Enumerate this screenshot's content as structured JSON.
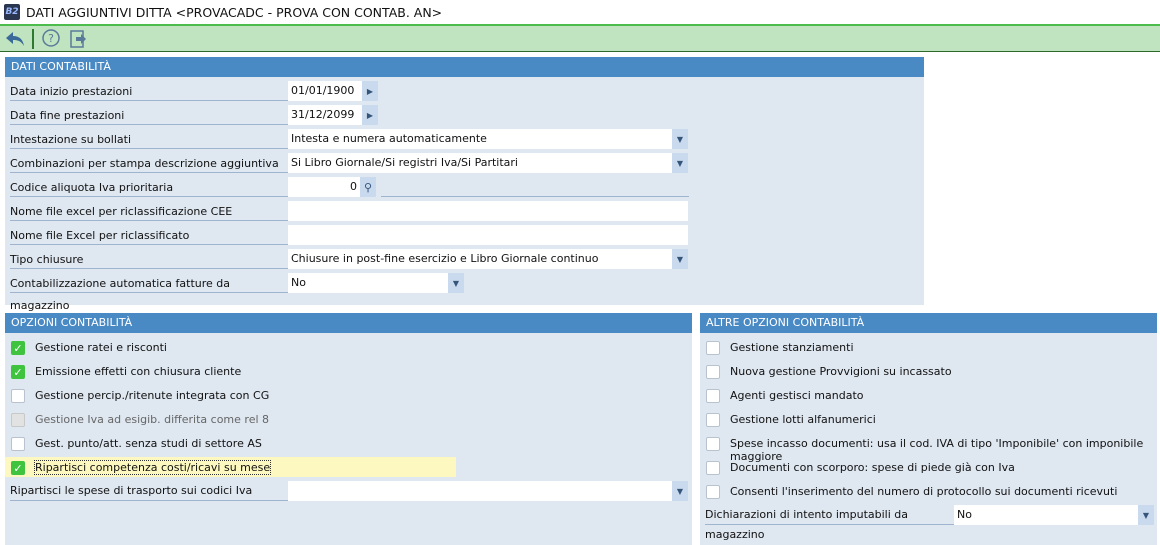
{
  "window": {
    "title": "DATI AGGIUNTIVI DITTA <PROVACADC - PROVA CON CONTAB. AN>",
    "icon_text": "B2"
  },
  "toolbar": {
    "buttons": [
      "back-icon",
      "help-icon",
      "exit-icon"
    ]
  },
  "dati": {
    "header": "DATI CONTABILITÀ",
    "data_inizio": {
      "label": "Data inizio prestazioni",
      "value": "01/01/1900"
    },
    "data_fine": {
      "label": "Data fine prestazioni",
      "value": "31/12/2099"
    },
    "intestazione": {
      "label": "Intestazione su bollati",
      "value": "Intesta e numera automaticamente"
    },
    "combinazioni": {
      "label": "Combinazioni per stampa descrizione aggiuntiva",
      "value": "Si Libro Giornale/Si registri Iva/Si Partitari"
    },
    "aliquota": {
      "label": "Codice aliquota Iva prioritaria",
      "value": "0"
    },
    "excel_cee": {
      "label": "Nome file excel per riclassificazione CEE",
      "value": ""
    },
    "excel_ric": {
      "label": "Nome file Excel per riclassificato",
      "value": ""
    },
    "chiusure": {
      "label": "Tipo chiusure",
      "value": "Chiusure in post-fine esercizio e Libro Giornale continuo"
    },
    "contab_auto": {
      "label": "Contabilizzazione automatica fatture da magazzino",
      "value": "No"
    }
  },
  "opzioni": {
    "header": "OPZIONI CONTABILITÀ",
    "items": [
      {
        "label": "Gestione ratei e risconti",
        "checked": true
      },
      {
        "label": "Emissione effetti con chiusura cliente",
        "checked": true
      },
      {
        "label": "Gestione percip./ritenute integrata con CG",
        "checked": false
      },
      {
        "label": "Gestione Iva ad esigib. differita come rel 8",
        "checked": false,
        "disabled": true
      },
      {
        "label": "Gest. punto/att. senza studi di settore AS",
        "checked": false
      },
      {
        "label": "Ripartisci competenza costi/ricavi su mese",
        "checked": true
      }
    ],
    "trasporto": {
      "label": "Ripartisci le spese di trasporto sui codici Iva",
      "value": ""
    }
  },
  "altre": {
    "header": "ALTRE OPZIONI CONTABILITÀ",
    "items": [
      {
        "label": "Gestione stanziamenti",
        "checked": false
      },
      {
        "label": "Nuova gestione Provvigioni su incassato",
        "checked": false
      },
      {
        "label": "Agenti gestisci mandato",
        "checked": false
      },
      {
        "label": "Gestione lotti alfanumerici",
        "checked": false
      },
      {
        "label": "Spese incasso documenti: usa il cod. IVA di tipo 'Imponibile' con imponibile maggiore",
        "checked": false
      },
      {
        "label": "Documenti con scorporo: spese di piede già con Iva",
        "checked": false
      },
      {
        "label": "Consenti l'inserimento del numero di protocollo sui documenti ricevuti",
        "checked": false
      }
    ],
    "intento": {
      "label": "Dichiarazioni di intento imputabili da magazzino",
      "value": "No"
    }
  }
}
